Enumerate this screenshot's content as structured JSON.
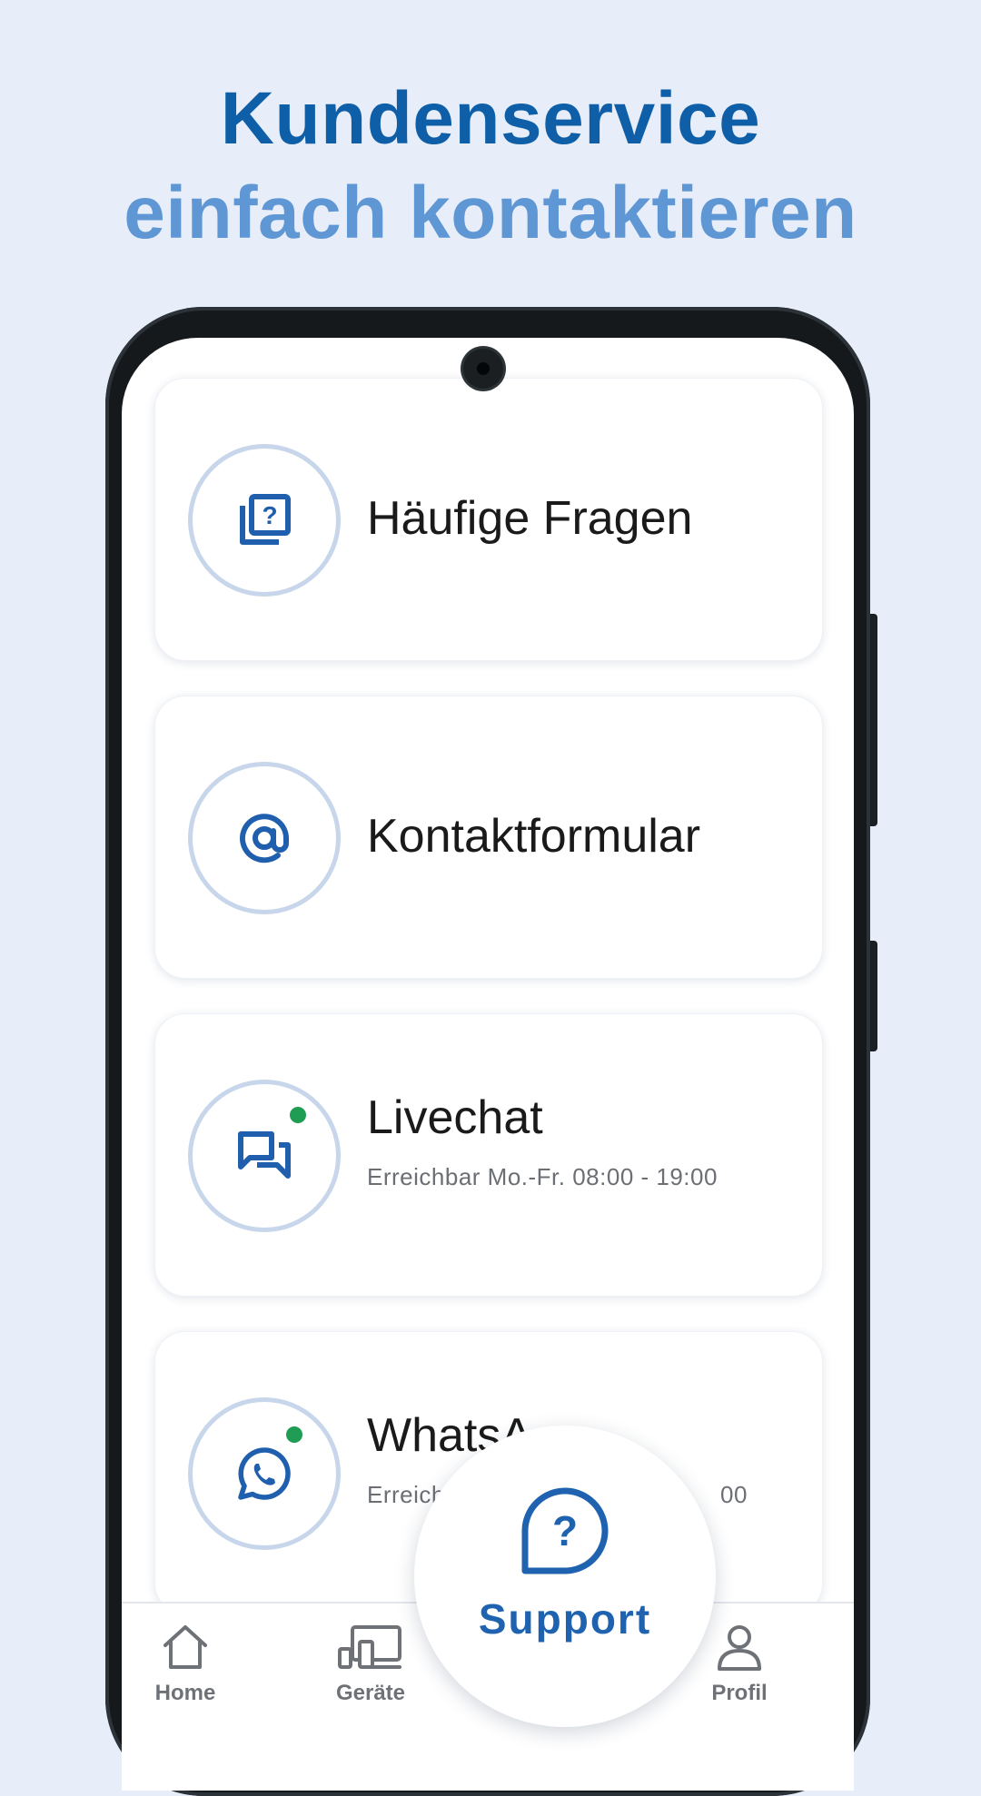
{
  "headline": {
    "line1": "Kundenservice",
    "line2": "einfach kontaktieren"
  },
  "cards": [
    {
      "title": "Häufige Fragen",
      "subtitle": "",
      "icon": "faq-icon"
    },
    {
      "title": "Kontaktformular",
      "subtitle": "",
      "icon": "at-sign-icon"
    },
    {
      "title": "Livechat",
      "subtitle": "Erreichbar Mo.-Fr. 08:00 - 19:00",
      "icon": "chat-bubbles-icon",
      "status": "online"
    },
    {
      "title": "WhatsA",
      "subtitle": "Erreich",
      "subtitle_tail": "00",
      "icon": "whatsapp-icon",
      "status": "online"
    }
  ],
  "nav": {
    "home": "Home",
    "devices": "Geräte",
    "support": "Support",
    "profile": "Profil"
  },
  "colors": {
    "background": "#e7eef9",
    "headline_dark": "#0e5fa8",
    "headline_light": "#5f97d4",
    "accent": "#1f63b0",
    "online": "#1f9d55"
  }
}
